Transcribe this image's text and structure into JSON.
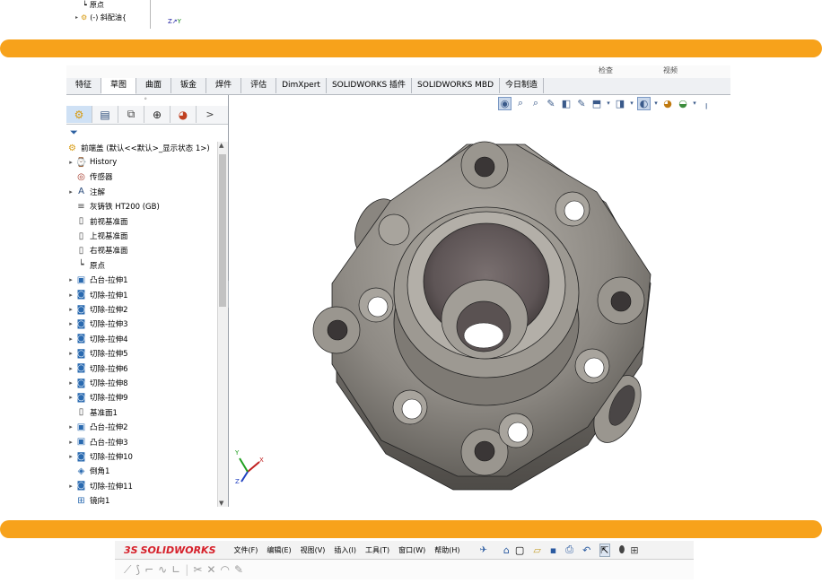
{
  "top_strip": {
    "rows": [
      {
        "icon": "origin-icon",
        "label": "原点"
      },
      {
        "icon": "part-icon",
        "label": "(-) 斜配油{"
      }
    ]
  },
  "tabs": [
    "特征",
    "草图",
    "曲面",
    "钣金",
    "焊件",
    "评估",
    "DimXpert",
    "SOLIDWORKS 插件",
    "SOLIDWORKS MBD",
    "今日制造"
  ],
  "active_tab_index": 1,
  "top_line_fragments": [
    "检查",
    "视频"
  ],
  "panel": {
    "tabs": [
      "feature-manager-icon",
      "property-manager-icon",
      "configuration-manager-icon",
      "dimxpert-icon",
      "display-manager-icon"
    ],
    "more": ">",
    "filter_icon": "filter-icon",
    "root": "前端盖 (默认<<默认>_显示状态 1>)",
    "items": [
      {
        "label": "History",
        "icon": "history-icon",
        "expandable": true
      },
      {
        "label": "传感器",
        "icon": "sensor-icon",
        "expandable": false
      },
      {
        "label": "注解",
        "icon": "annotation-icon",
        "expandable": true
      },
      {
        "label": "灰铸铁 HT200 (GB)",
        "icon": "material-icon",
        "expandable": false
      },
      {
        "label": "前视基准面",
        "icon": "plane-icon",
        "expandable": false
      },
      {
        "label": "上视基准面",
        "icon": "plane-icon",
        "expandable": false
      },
      {
        "label": "右视基准面",
        "icon": "plane-icon",
        "expandable": false
      },
      {
        "label": "原点",
        "icon": "origin-icon",
        "expandable": false
      },
      {
        "label": "凸台-拉伸1",
        "icon": "boss-extrude-icon",
        "expandable": true
      },
      {
        "label": "切除-拉伸1",
        "icon": "cut-extrude-icon",
        "expandable": true
      },
      {
        "label": "切除-拉伸2",
        "icon": "cut-extrude-icon",
        "expandable": true
      },
      {
        "label": "切除-拉伸3",
        "icon": "cut-extrude-icon",
        "expandable": true
      },
      {
        "label": "切除-拉伸4",
        "icon": "cut-extrude-icon",
        "expandable": true
      },
      {
        "label": "切除-拉伸5",
        "icon": "cut-extrude-icon",
        "expandable": true
      },
      {
        "label": "切除-拉伸6",
        "icon": "cut-extrude-icon",
        "expandable": true
      },
      {
        "label": "切除-拉伸8",
        "icon": "cut-extrude-icon",
        "expandable": true
      },
      {
        "label": "切除-拉伸9",
        "icon": "cut-extrude-icon",
        "expandable": true
      },
      {
        "label": "基准面1",
        "icon": "plane-icon",
        "expandable": false
      },
      {
        "label": "凸台-拉伸2",
        "icon": "boss-extrude-icon",
        "expandable": true
      },
      {
        "label": "凸台-拉伸3",
        "icon": "boss-extrude-icon",
        "expandable": true
      },
      {
        "label": "切除-拉伸10",
        "icon": "cut-extrude-icon",
        "expandable": true
      },
      {
        "label": "倒角1",
        "icon": "chamfer-icon",
        "expandable": false
      },
      {
        "label": "切除-拉伸11",
        "icon": "cut-extrude-icon",
        "expandable": true
      },
      {
        "label": "镜向1",
        "icon": "mirror-icon",
        "expandable": false
      }
    ]
  },
  "triad_labels": {
    "x": "X",
    "y": "Y",
    "z": "Z"
  },
  "bottom": {
    "brand_ds": "3S",
    "brand_name": "SOLIDWORKS",
    "menus": [
      "文件(F)",
      "编辑(E)",
      "视图(V)",
      "插入(I)",
      "工具(T)",
      "窗口(W)",
      "帮助(H)"
    ]
  },
  "colors": {
    "divider": "#f7a21b",
    "model_face": "#8e8a84",
    "brand_red": "#d6202a"
  }
}
